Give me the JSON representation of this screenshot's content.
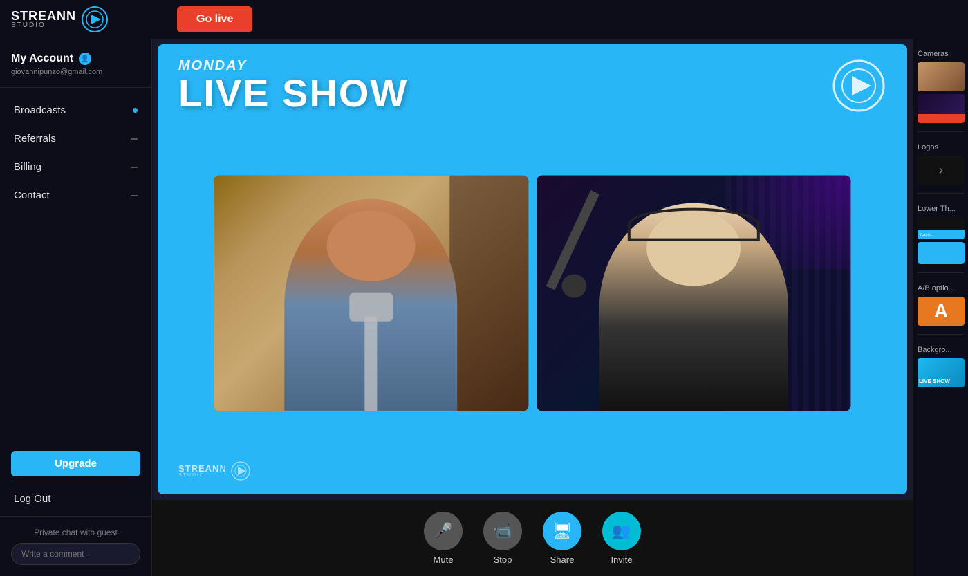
{
  "app": {
    "name": "STREANN",
    "sub": "STUDIO",
    "logo_symbol": "◁▷"
  },
  "topbar": {
    "go_live_label": "Go live"
  },
  "sidebar": {
    "account_label": "My Account",
    "account_email": "giovannipunzo@gmail.com",
    "nav_items": [
      {
        "label": "Broadcasts",
        "indicator": "dot"
      },
      {
        "label": "Referrals",
        "indicator": "dash"
      },
      {
        "label": "Billing",
        "indicator": "dash"
      },
      {
        "label": "Contact",
        "indicator": "dash"
      }
    ],
    "upgrade_label": "Upgrade",
    "logout_label": "Log Out",
    "private_chat_label": "Private chat with guest",
    "comment_placeholder": "Write a comment"
  },
  "stage": {
    "day": "MONDAY",
    "title": "LIVE SHOW",
    "brand": "STREANN",
    "brand_sub": "STUDIO"
  },
  "controls": [
    {
      "id": "mute",
      "label": "Mute",
      "icon": "🎤",
      "style": "gray"
    },
    {
      "id": "stop",
      "label": "Stop",
      "icon": "📹",
      "style": "gray"
    },
    {
      "id": "share",
      "label": "Share",
      "icon": "🖥",
      "style": "blue"
    },
    {
      "id": "invite",
      "label": "Invite",
      "icon": "👥",
      "style": "cyan"
    }
  ],
  "right_panel": {
    "cameras_label": "Cameras",
    "logos_label": "Logos",
    "lower_thirds_label": "Lower Th...",
    "ab_label": "A/B optio...",
    "backgrounds_label": "Backgro...",
    "lower_third_text": "Your te...",
    "ab_letter": "A",
    "bg_text": "LIVE SHOW"
  }
}
